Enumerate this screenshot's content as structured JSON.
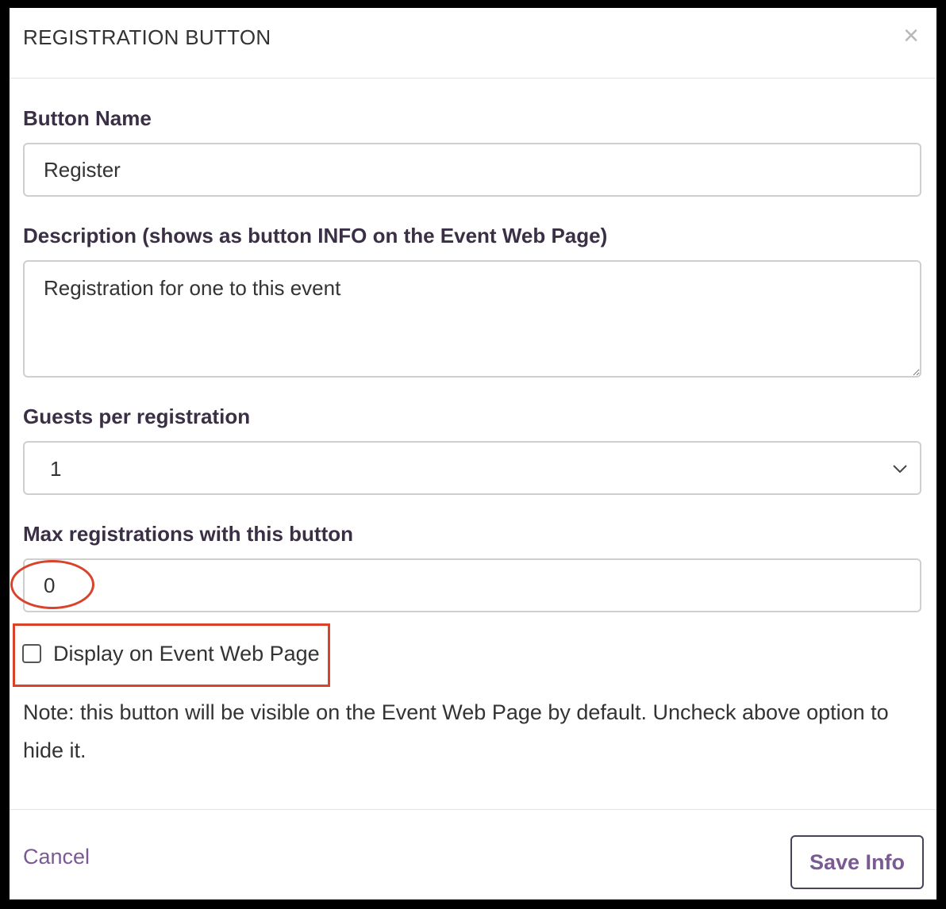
{
  "modal": {
    "title": "REGISTRATION BUTTON",
    "close_icon": "close-icon"
  },
  "form": {
    "button_name": {
      "label": "Button Name",
      "value": "Register"
    },
    "description": {
      "label": "Description (shows as button INFO on the Event Web Page)",
      "value": "Registration for one to this event"
    },
    "guests": {
      "label": "Guests per registration",
      "value": "1",
      "icon": "chevron-down-icon"
    },
    "max_registrations": {
      "label": "Max registrations with this button",
      "value": "0"
    },
    "display_checkbox": {
      "label": "Display on Event Web Page",
      "checked": false
    },
    "note": "Note: this button will be visible on the Event Web Page by default. Uncheck above option to hide it."
  },
  "footer": {
    "cancel_label": "Cancel",
    "save_label": "Save Info"
  },
  "colors": {
    "accent": "#7b5a94",
    "annotation": "#d9422b",
    "label_text": "#3a2f45"
  }
}
